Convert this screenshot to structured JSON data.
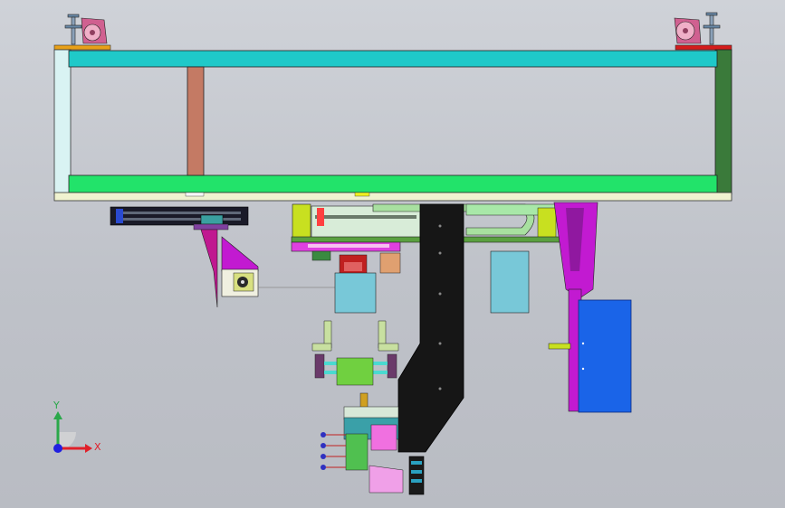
{
  "viewport": {
    "background": "#c4c7cd"
  },
  "triad": {
    "x_label": "X",
    "y_label": "Y",
    "x_color": "#e0202a",
    "y_color": "#2aa84a",
    "origin_color": "#2020e0"
  },
  "colors": {
    "frame_top": "#1fc9c9",
    "frame_bottom": "#22e36a",
    "frame_left": "#d9f3f3",
    "frame_right": "#3a7a3a",
    "post": "#c47a64",
    "lift_arm": "#161616",
    "control_box": "#1a64e8",
    "magenta_bracket": "#c21ad1"
  }
}
